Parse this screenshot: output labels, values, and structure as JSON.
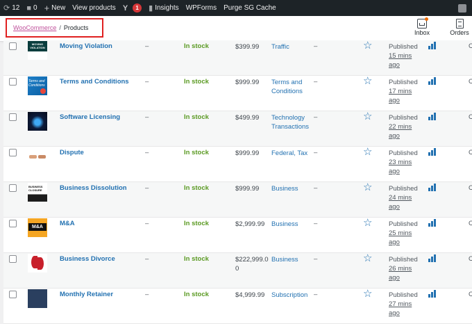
{
  "adminbar": {
    "updates_count": "12",
    "comments_count": "0",
    "new_label": "New",
    "view_products_label": "View products",
    "yoast_badge": "1",
    "insights_label": "Insights",
    "wpforms_label": "WPForms",
    "purge_label": "Purge SG Cache"
  },
  "header": {
    "breadcrumb_parent": "WooCommerce",
    "breadcrumb_separator": "/",
    "breadcrumb_current": "Products",
    "inbox_label": "Inbox",
    "orders_label": "Orders"
  },
  "products": [
    {
      "name": "Moving Violation",
      "thumb_text": "MOVING VIOLATION",
      "sku": "–",
      "stock": "In stock",
      "price": "$399.99",
      "categories": "Traffic",
      "tags": "–",
      "status": "Published",
      "ago": "15 mins ago",
      "more": "C"
    },
    {
      "name": "Terms and Conditions",
      "thumb_text": "Terms and Conditions",
      "sku": "–",
      "stock": "In stock",
      "price": "$999.99",
      "categories": "Terms and Conditions",
      "tags": "–",
      "status": "Published",
      "ago": "17 mins ago",
      "more": "C"
    },
    {
      "name": "Software Licensing",
      "thumb_text": "",
      "sku": "–",
      "stock": "In stock",
      "price": "$499.99",
      "categories": "Technology Transactions",
      "tags": "–",
      "status": "Published",
      "ago": "22 mins ago",
      "more": "C"
    },
    {
      "name": "Dispute",
      "thumb_text": "",
      "sku": "–",
      "stock": "In stock",
      "price": "$999.99",
      "categories": "Federal, Tax",
      "tags": "–",
      "status": "Published",
      "ago": "23 mins ago",
      "more": "C"
    },
    {
      "name": "Business Dissolution",
      "thumb_text": "BUSINESS CLOSURE",
      "sku": "–",
      "stock": "In stock",
      "price": "$999.99",
      "categories": "Business",
      "tags": "–",
      "status": "Published",
      "ago": "24 mins ago",
      "more": "C"
    },
    {
      "name": "M&A",
      "thumb_text": "M&A",
      "sku": "–",
      "stock": "In stock",
      "price": "$2,999.99",
      "categories": "Business",
      "tags": "–",
      "status": "Published",
      "ago": "25 mins ago",
      "more": "C"
    },
    {
      "name": "Business Divorce",
      "thumb_text": "",
      "sku": "–",
      "stock": "In stock",
      "price": "$222,999.00",
      "categories": "Business",
      "tags": "–",
      "status": "Published",
      "ago": "26 mins ago",
      "more": "C"
    },
    {
      "name": "Monthly Retainer",
      "thumb_text": "",
      "sku": "–",
      "stock": "In stock",
      "price": "$4,999.99",
      "categories": "Subscription",
      "tags": "–",
      "status": "Published",
      "ago": "27 mins ago",
      "more": "C"
    }
  ],
  "colors": {
    "adminbar_bg": "#1d2327",
    "link_blue": "#2271b1",
    "in_stock_green": "#5b9a23",
    "breadcrumb_link": "#bf4f9a",
    "highlight_red": "#e02020"
  }
}
